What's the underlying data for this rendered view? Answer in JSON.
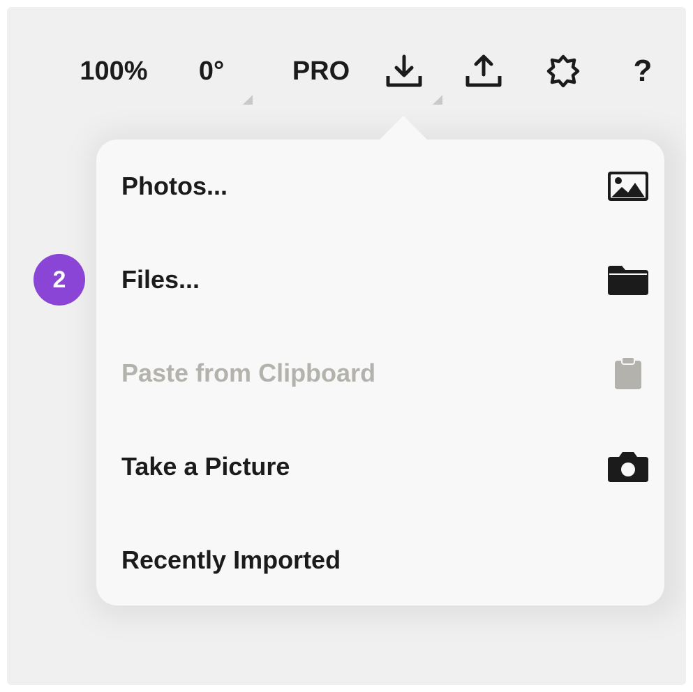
{
  "toolbar": {
    "zoom": "100%",
    "rotation": "0°",
    "pro_label": "PRO",
    "import_icon": "download-icon",
    "export_icon": "upload-icon",
    "settings_icon": "gear-icon",
    "help_label": "?"
  },
  "import_menu": {
    "items": [
      {
        "label": "Photos...",
        "icon": "image-icon",
        "enabled": true
      },
      {
        "label": "Files...",
        "icon": "folder-icon",
        "enabled": true
      },
      {
        "label": "Paste from Clipboard",
        "icon": "clipboard-icon",
        "enabled": false
      },
      {
        "label": "Take a Picture",
        "icon": "camera-icon",
        "enabled": true
      },
      {
        "label": "Recently Imported",
        "icon": "",
        "enabled": true
      }
    ]
  },
  "step_badge": {
    "number": "2"
  },
  "colors": {
    "text": "#1b1b1b",
    "disabled_text": "#b3b2ad",
    "badge": "#8a44d6",
    "popover_bg": "#f8f8f8",
    "background": "#f0f0f0"
  }
}
